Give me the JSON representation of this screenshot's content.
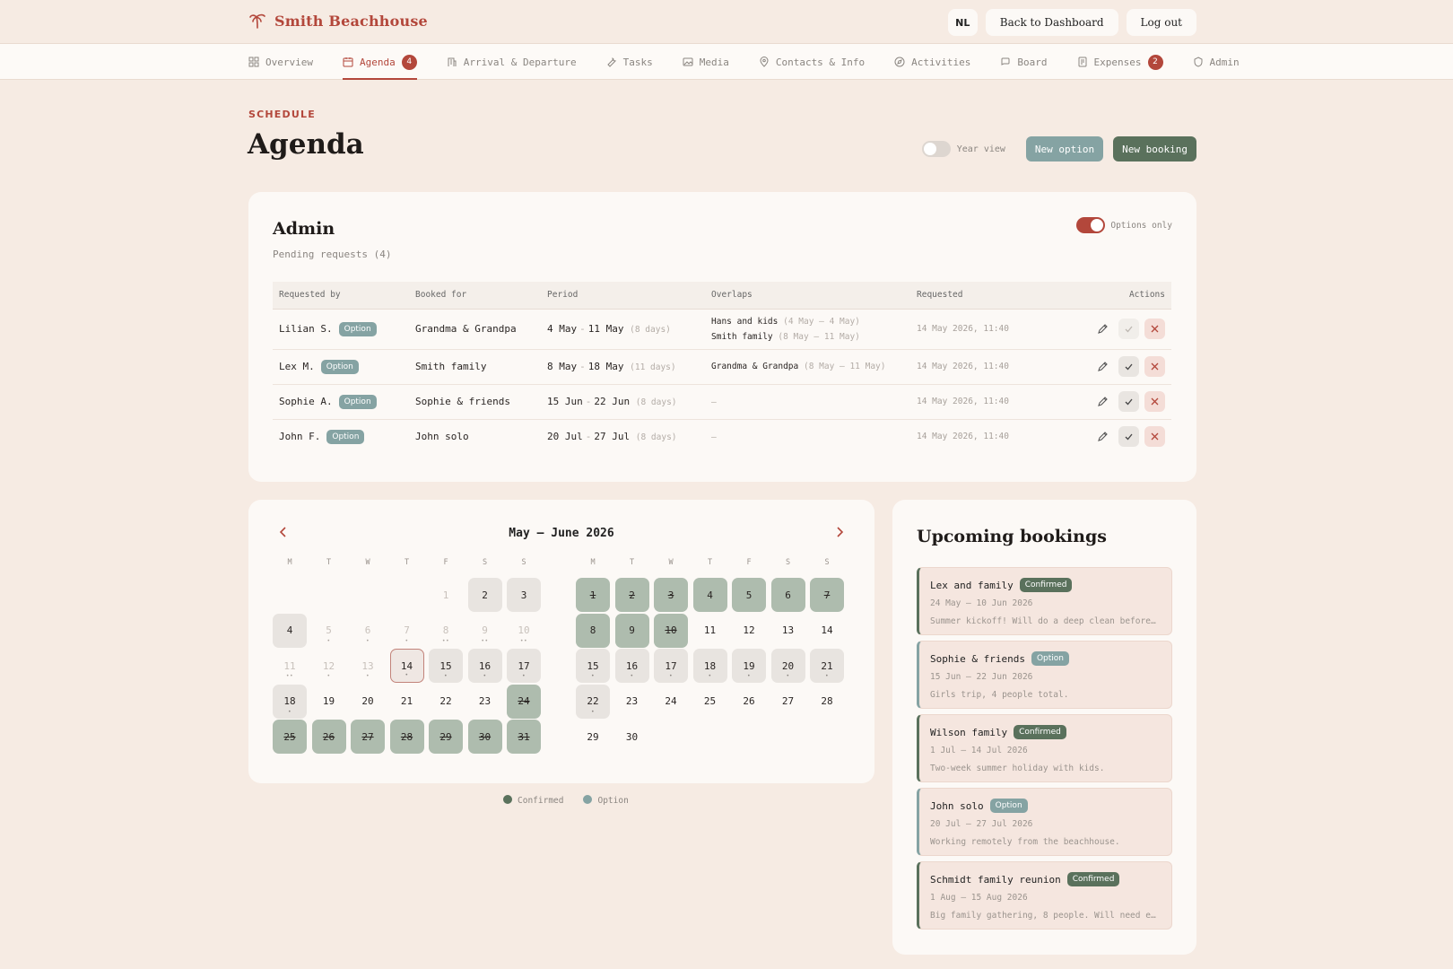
{
  "brand": {
    "name": "Smith Beachhouse"
  },
  "top_actions": {
    "lang": "NL",
    "dashboard": "Back to Dashboard",
    "logout": "Log out"
  },
  "nav": [
    {
      "label": "Overview",
      "icon": "grid-icon"
    },
    {
      "label": "Agenda",
      "icon": "calendar-icon",
      "badge": "4",
      "active": true
    },
    {
      "label": "Arrival & Departure",
      "icon": "building-icon"
    },
    {
      "label": "Tasks",
      "icon": "wrench-icon"
    },
    {
      "label": "Media",
      "icon": "image-icon"
    },
    {
      "label": "Contacts & Info",
      "icon": "pin-icon"
    },
    {
      "label": "Activities",
      "icon": "compass-icon"
    },
    {
      "label": "Board",
      "icon": "chat-icon"
    },
    {
      "label": "Expenses",
      "icon": "receipt-icon",
      "badge": "2"
    },
    {
      "label": "Admin",
      "icon": "shield-icon"
    }
  ],
  "header": {
    "eyebrow": "SCHEDULE",
    "title": "Agenda",
    "year_view": "Year view",
    "new_option": "New option",
    "new_booking": "New booking"
  },
  "admin": {
    "title": "Admin",
    "subtitle": "Pending requests (4)",
    "options_only": "Options only",
    "columns": [
      "Requested by",
      "Booked for",
      "Period",
      "Overlaps",
      "Requested",
      "Actions"
    ],
    "rows": [
      {
        "by": "Lilian S.",
        "tag": "Option",
        "for": "Grandma & Grandpa",
        "from": "4 May",
        "to": "11 May",
        "days": "(8 days)",
        "overlaps": [
          {
            "name": "Hans and kids",
            "range": "(4 May – 4 May)"
          },
          {
            "name": "Smith family",
            "range": "(8 May – 11 May)"
          }
        ],
        "requested": "14 May 2026, 11:40"
      },
      {
        "by": "Lex M.",
        "tag": "Option",
        "for": "Smith family",
        "from": "8 May",
        "to": "18 May",
        "days": "(11 days)",
        "overlaps": [
          {
            "name": "Grandma & Grandpa",
            "range": "(8 May – 11 May)"
          }
        ],
        "requested": "14 May 2026, 11:40"
      },
      {
        "by": "Sophie A.",
        "tag": "Option",
        "for": "Sophie & friends",
        "from": "15 Jun",
        "to": "22 Jun",
        "days": "(8 days)",
        "overlaps": [],
        "no_overlap": "–",
        "requested": "14 May 2026, 11:40"
      },
      {
        "by": "John F.",
        "tag": "Option",
        "for": "John solo",
        "from": "20 Jul",
        "to": "27 Jul",
        "days": "(8 days)",
        "overlaps": [],
        "no_overlap": "–",
        "requested": "14 May 2026, 11:40"
      }
    ]
  },
  "calendar": {
    "title": "May – June 2026",
    "weekdays": [
      "M",
      "T",
      "W",
      "T",
      "F",
      "S",
      "S"
    ],
    "months": [
      {
        "offset": 4,
        "days": [
          {
            "n": "1",
            "s": "past"
          },
          {
            "n": "2",
            "s": "opt"
          },
          {
            "n": "3",
            "s": "opt"
          },
          {
            "n": "4",
            "s": "opt"
          },
          {
            "n": "5",
            "s": "past",
            "dots": "•"
          },
          {
            "n": "6",
            "s": "past",
            "dots": "•"
          },
          {
            "n": "7",
            "s": "past",
            "dots": "•"
          },
          {
            "n": "8",
            "s": "past",
            "dots": "••"
          },
          {
            "n": "9",
            "s": "past",
            "dots": "••"
          },
          {
            "n": "10",
            "s": "past",
            "dots": "••"
          },
          {
            "n": "11",
            "s": "past",
            "dots": "••"
          },
          {
            "n": "12",
            "s": "past",
            "dots": "•"
          },
          {
            "n": "13",
            "s": "past",
            "dots": "•"
          },
          {
            "n": "14",
            "s": "today",
            "dots": "•"
          },
          {
            "n": "15",
            "s": "opt",
            "dots": "•"
          },
          {
            "n": "16",
            "s": "opt",
            "dots": "•"
          },
          {
            "n": "17",
            "s": "opt",
            "dots": "•"
          },
          {
            "n": "18",
            "s": "opt",
            "dots": "•"
          },
          {
            "n": "19"
          },
          {
            "n": "20"
          },
          {
            "n": "21"
          },
          {
            "n": "22"
          },
          {
            "n": "23"
          },
          {
            "n": "24",
            "s": "conf"
          },
          {
            "n": "25",
            "s": "conf"
          },
          {
            "n": "26",
            "s": "conf"
          },
          {
            "n": "27",
            "s": "conf"
          },
          {
            "n": "28",
            "s": "conf"
          },
          {
            "n": "29",
            "s": "conf"
          },
          {
            "n": "30",
            "s": "conf"
          },
          {
            "n": "31",
            "s": "conf"
          }
        ]
      },
      {
        "offset": 0,
        "days": [
          {
            "n": "1",
            "s": "conf"
          },
          {
            "n": "2",
            "s": "conf"
          },
          {
            "n": "3",
            "s": "conf"
          },
          {
            "n": "4",
            "s": "conf-ns"
          },
          {
            "n": "5",
            "s": "conf-ns"
          },
          {
            "n": "6",
            "s": "conf-ns"
          },
          {
            "n": "7",
            "s": "conf"
          },
          {
            "n": "8",
            "s": "conf-ns"
          },
          {
            "n": "9",
            "s": "conf-ns"
          },
          {
            "n": "10",
            "s": "conf"
          },
          {
            "n": "11"
          },
          {
            "n": "12"
          },
          {
            "n": "13"
          },
          {
            "n": "14"
          },
          {
            "n": "15",
            "s": "opt",
            "dots": "•"
          },
          {
            "n": "16",
            "s": "opt",
            "dots": "•"
          },
          {
            "n": "17",
            "s": "opt",
            "dots": "•"
          },
          {
            "n": "18",
            "s": "opt",
            "dots": "•"
          },
          {
            "n": "19",
            "s": "opt",
            "dots": "•"
          },
          {
            "n": "20",
            "s": "opt",
            "dots": "•"
          },
          {
            "n": "21",
            "s": "opt",
            "dots": "•"
          },
          {
            "n": "22",
            "s": "opt",
            "dots": "•"
          },
          {
            "n": "23"
          },
          {
            "n": "24"
          },
          {
            "n": "25"
          },
          {
            "n": "26"
          },
          {
            "n": "27"
          },
          {
            "n": "28"
          },
          {
            "n": "29"
          },
          {
            "n": "30"
          }
        ]
      }
    ],
    "legend": {
      "confirmed": "Confirmed",
      "option": "Option"
    }
  },
  "upcoming": {
    "title": "Upcoming bookings",
    "items": [
      {
        "name": "Lex and family",
        "status": "Confirmed",
        "dates": "24 May — 10 Jun 2026",
        "note": "Summer kickoff! Will do a deep clean before…"
      },
      {
        "name": "Sophie & friends",
        "status": "Option",
        "dates": "15 Jun — 22 Jun 2026",
        "note": "Girls trip, 4 people total."
      },
      {
        "name": "Wilson family",
        "status": "Confirmed",
        "dates": "1 Jul — 14 Jul 2026",
        "note": "Two-week summer holiday with kids."
      },
      {
        "name": "John solo",
        "status": "Option",
        "dates": "20 Jul — 27 Jul 2026",
        "note": "Working remotely from the beachhouse."
      },
      {
        "name": "Schmidt family reunion",
        "status": "Confirmed",
        "dates": "1 Aug — 15 Aug 2026",
        "note": "Big family gathering, 8 people. Will need e…"
      }
    ]
  },
  "colors": {
    "accent": "#b3473b",
    "confirmed": "#5a715c",
    "option": "#85a3a3",
    "background": "#f6ebe3"
  }
}
